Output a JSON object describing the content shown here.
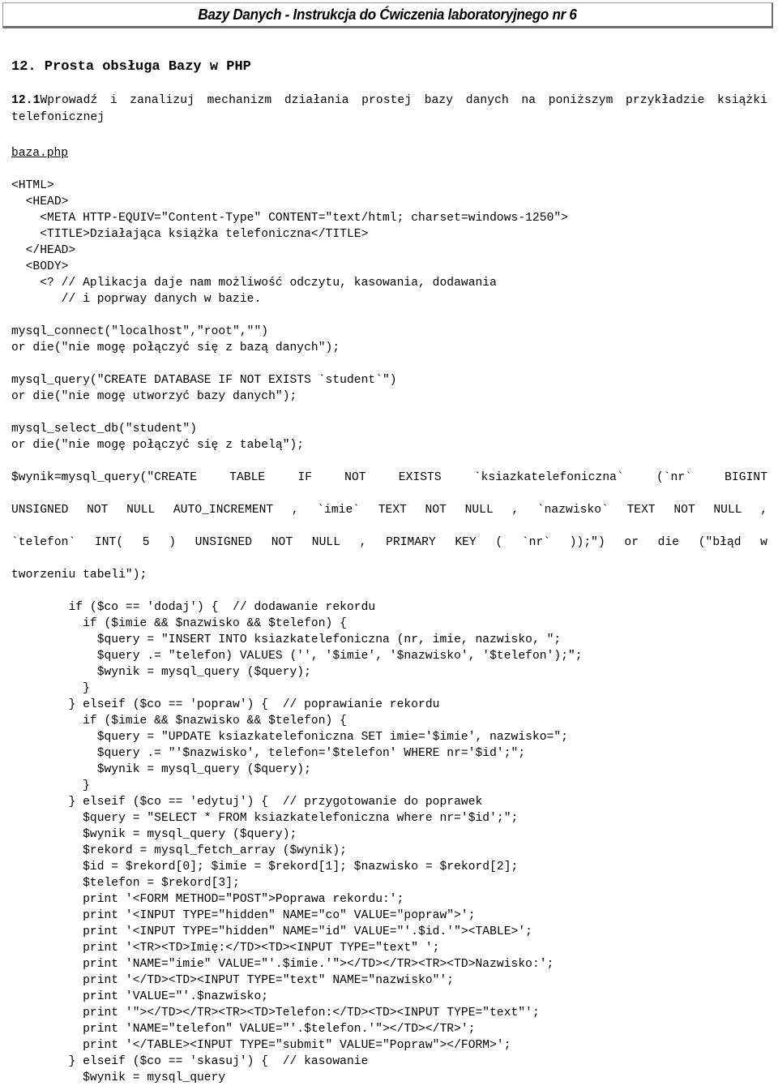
{
  "header": {
    "running_title": "Bazy Danych - Instrukcja do Ćwiczenia laboratoryjnego nr 6"
  },
  "document": {
    "section_number": "12.",
    "section_title": "12. Prosta obsługa Bazy w PHP",
    "subsection_label": "12.1",
    "subsection_text": "Wprowadź i zanalizuj mechanizm działania prostej bazy danych na poniższym przykładzie książki telefonicznej",
    "filename": "baza.php"
  },
  "code": {
    "block_html_head": "<HTML>\n  <HEAD>\n    <META HTTP-EQUIV=\"Content-Type\" CONTENT=\"text/html; charset=windows-1250\">\n    <TITLE>Działająca książka telefoniczna</TITLE>\n  </HEAD>\n  <BODY>\n    <? // Aplikacja daje nam możliwość odczytu, kasowania, dodawania\n       // i poprway danych w bazie.",
    "block_connect": "mysql_connect(\"localhost\",\"root\",\"\")\nor die(\"nie mogę połączyć się z bazą danych\");",
    "block_create_db": "mysql_query(\"CREATE DATABASE IF NOT EXISTS `student`\")\nor die(\"nie mogę utworzyć bazy danych\");",
    "block_select_db": "mysql_select_db(\"student\")\nor die(\"nie mogę połączyć się z tabelą\");",
    "create_table_line1": " $wynik=mysql_query(\"CREATE TABLE IF NOT EXISTS `ksiazkatelefoniczna` (`nr` BIGINT",
    "create_table_line2": "UNSIGNED NOT NULL AUTO_INCREMENT , `imie` TEXT NOT NULL , `nazwisko` TEXT NOT NULL ,",
    "create_table_line3": "`telefon` INT( 5 ) UNSIGNED NOT NULL , PRIMARY KEY ( `nr` ));\") or die (\"błąd w",
    "create_table_line4": "tworzeniu tabeli\");",
    "block_logic": "        if ($co == 'dodaj') {  // dodawanie rekordu\n          if ($imie && $nazwisko && $telefon) {\n            $query = \"INSERT INTO ksiazkatelefoniczna (nr, imie, nazwisko, \";\n            $query .= \"telefon) VALUES ('', '$imie', '$nazwisko', '$telefon');\";\n            $wynik = mysql_query ($query);\n          }\n        } elseif ($co == 'popraw') {  // poprawianie rekordu\n          if ($imie && $nazwisko && $telefon) {\n            $query = \"UPDATE ksiazkatelefoniczna SET imie='$imie', nazwisko=\";\n            $query .= \"'$nazwisko', telefon='$telefon' WHERE nr='$id';\";\n            $wynik = mysql_query ($query);\n          }\n        } elseif ($co == 'edytuj') {  // przygotowanie do poprawek\n          $query = \"SELECT * FROM ksiazkatelefoniczna where nr='$id';\";\n          $wynik = mysql_query ($query);\n          $rekord = mysql_fetch_array ($wynik);\n          $id = $rekord[0]; $imie = $rekord[1]; $nazwisko = $rekord[2];\n          $telefon = $rekord[3];\n          print '<FORM METHOD=\"POST\">Poprawa rekordu:';\n          print '<INPUT TYPE=\"hidden\" NAME=\"co\" VALUE=\"popraw\">';\n          print '<INPUT TYPE=\"hidden\" NAME=\"id\" VALUE=\"'.$id.'\"><TABLE>';\n          print '<TR><TD>Imię:</TD><TD><INPUT TYPE=\"text\" ';\n          print 'NAME=\"imie\" VALUE=\"'.$imie.'\"></TD></TR><TR><TD>Nazwisko:';\n          print '</TD><TD><INPUT TYPE=\"text\" NAME=\"nazwisko\"';\n          print 'VALUE=\"'.$nazwisko;\n          print '\"></TD></TR><TR><TD>Telefon:</TD><TD><INPUT TYPE=\"text\"';\n          print 'NAME=\"telefon\" VALUE=\"'.$telefon.'\"></TD></TR>';\n          print '</TABLE><INPUT TYPE=\"submit\" VALUE=\"Popraw\"></FORM>';\n        } elseif ($co == 'skasuj') {  // kasowanie\n          $wynik = mysql_query"
  }
}
